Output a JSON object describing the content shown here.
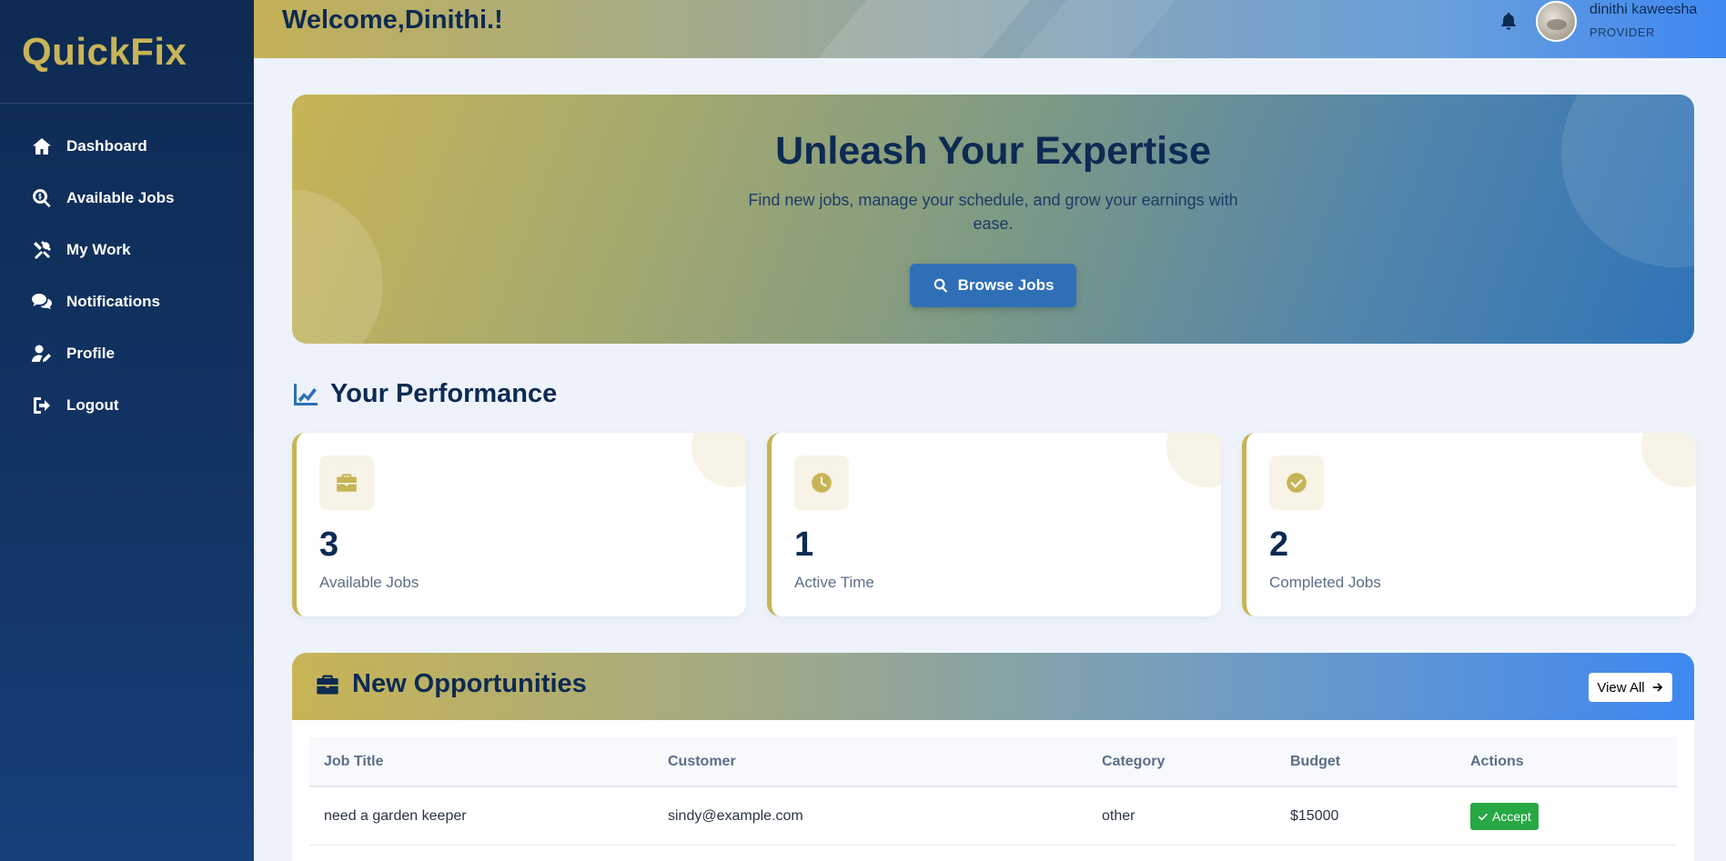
{
  "brand": "QuickFix",
  "sidebar": {
    "items": [
      {
        "label": "Dashboard",
        "icon": "home-icon"
      },
      {
        "label": "Available Jobs",
        "icon": "search-dollar-icon"
      },
      {
        "label": "My Work",
        "icon": "tools-icon"
      },
      {
        "label": "Notifications",
        "icon": "comments-icon"
      },
      {
        "label": "Profile",
        "icon": "user-edit-icon"
      },
      {
        "label": "Logout",
        "icon": "sign-out-icon"
      }
    ]
  },
  "header": {
    "welcome": "Welcome,Dinithi.!",
    "user_name": "dinithi kaweesha",
    "user_role": "PROVIDER"
  },
  "hero": {
    "title": "Unleash Your Expertise",
    "subtitle": "Find new jobs, manage your schedule, and grow your earnings with ease.",
    "button": "Browse Jobs"
  },
  "performance": {
    "title": "Your Performance",
    "cards": [
      {
        "value": "3",
        "label": "Available Jobs",
        "icon": "briefcase-icon"
      },
      {
        "value": "1",
        "label": "Active Time",
        "icon": "clock-icon"
      },
      {
        "value": "2",
        "label": "Completed Jobs",
        "icon": "check-circle-icon"
      }
    ]
  },
  "opportunities": {
    "title": "New Opportunities",
    "view_all": "View All",
    "columns": [
      "Job Title",
      "Customer",
      "Category",
      "Budget",
      "Actions"
    ],
    "rows": [
      {
        "job_title": "need a garden keeper",
        "customer": "sindy@example.com",
        "category": "other",
        "budget": "$15000",
        "action": "Accept"
      }
    ]
  },
  "colors": {
    "sidebar": "#0d2a52",
    "accent_gold": "#c7b456",
    "primary_blue": "#2f6fb6",
    "accept_green": "#28a745"
  }
}
